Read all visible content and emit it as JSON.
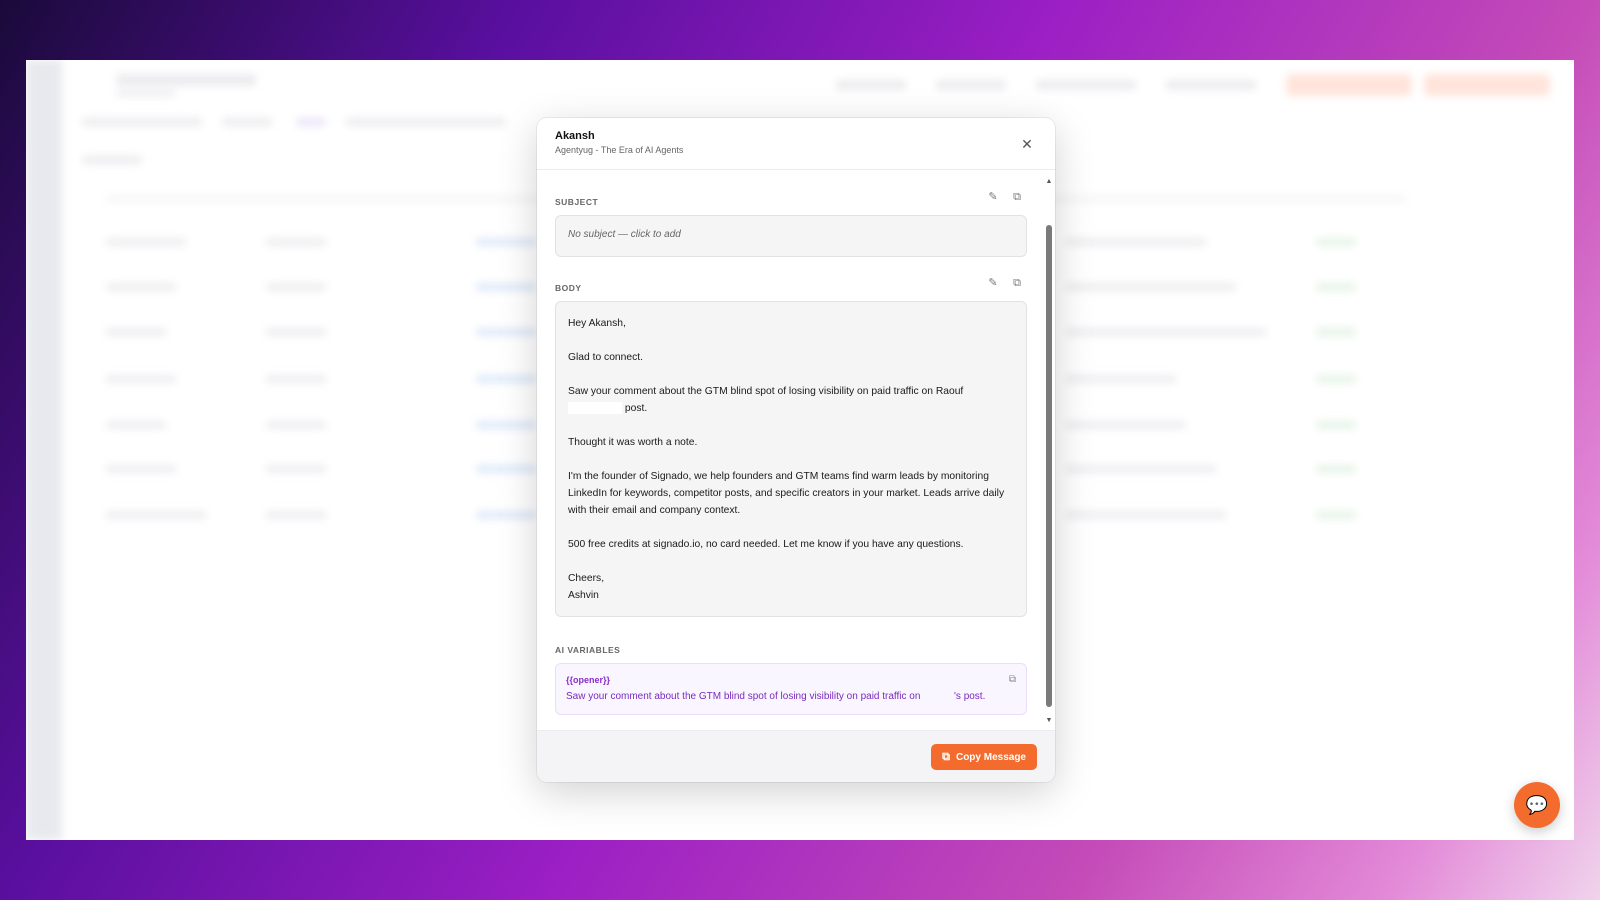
{
  "modal": {
    "title": "Akansh",
    "subtitle": "Agentyug - The Era of AI Agents",
    "close_icon": "close-icon"
  },
  "subject": {
    "label": "SUBJECT",
    "placeholder": "No subject — click to add"
  },
  "body": {
    "label": "BODY",
    "paragraphs": [
      "Hey Akansh,",
      "Glad to connect.",
      "Saw your comment about the GTM blind spot of losing visibility on paid traffic on Raouf",
      "post.",
      "Thought it was worth a note.",
      "I'm the founder of Signado, we help founders and GTM teams find warm leads by monitoring LinkedIn for keywords, competitor posts, and specific creators in your market. Leads arrive daily with their email and company context.",
      "500 free credits at signado.io, no card needed. Let me know if you have any questions.",
      "Cheers,",
      "Ashvin"
    ]
  },
  "ai_variables": {
    "label": "AI VARIABLES",
    "items": [
      {
        "name": "{{opener}}",
        "value_before": "Saw your comment about the GTM blind spot of losing visibility on paid traffic on",
        "value_after": "'s post."
      }
    ]
  },
  "footer": {
    "copy_label": "Copy Message"
  },
  "colors": {
    "accent": "#f46b2e",
    "ai_purple": "#7a2bc0"
  }
}
